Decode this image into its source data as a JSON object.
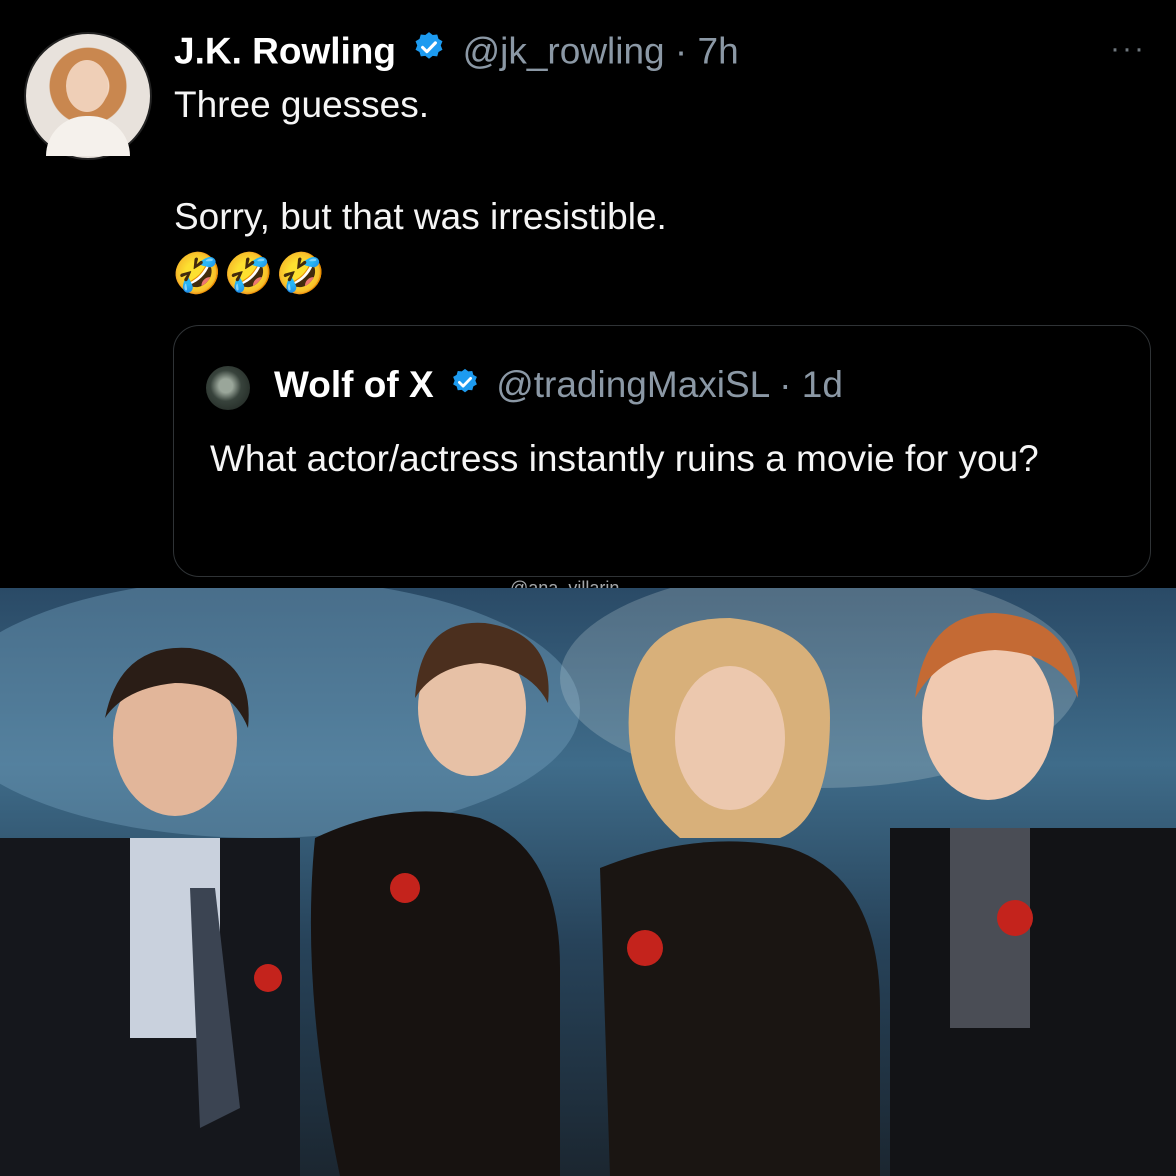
{
  "tweet": {
    "author_name": "J.K. Rowling",
    "author_handle": "@jk_rowling",
    "separator": "·",
    "time": "7h",
    "more": "···",
    "text_line1": "Three guesses.",
    "text_line2": "Sorry, but that was irresistible.",
    "emojis": "🤣🤣🤣",
    "verified_color": "#1d9bf0"
  },
  "quoted": {
    "author_name": "Wolf of X",
    "author_handle": "@tradingMaxiSL",
    "separator": "·",
    "time": "1d",
    "text": "What actor/actress instantly ruins a movie for you?"
  },
  "watermark": "@ana_villarin",
  "icons": [
    "verified-badge-icon",
    "more-options-icon"
  ]
}
